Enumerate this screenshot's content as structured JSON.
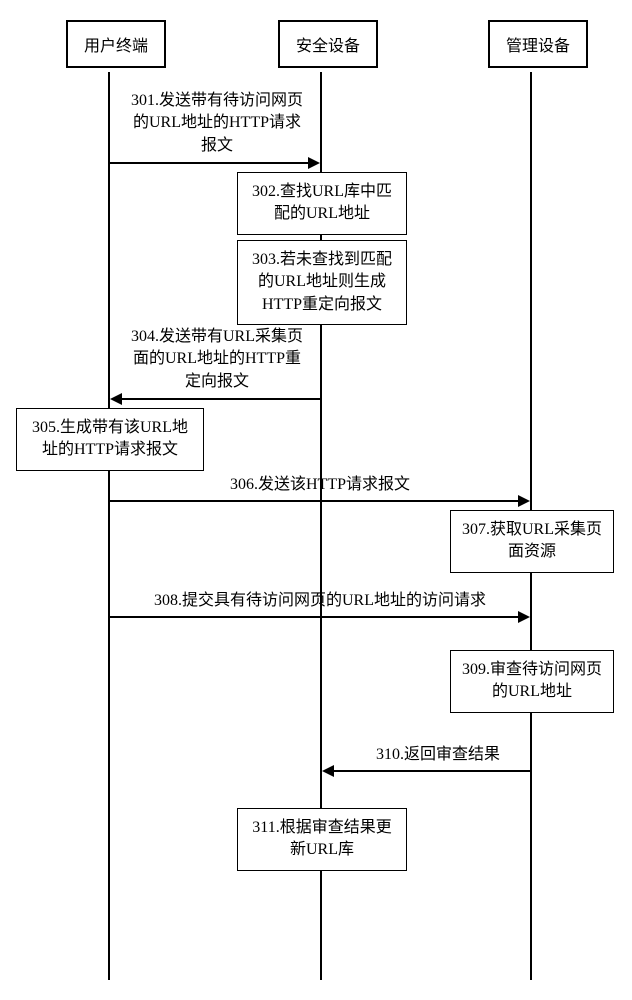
{
  "participants": {
    "user_terminal": "用户终端",
    "security_device": "安全设备",
    "management_device": "管理设备"
  },
  "messages": {
    "m301": "301.发送带有待访问网页的URL地址的HTTP请求报文",
    "m302": "302.查找URL库中匹配的URL地址",
    "m303": "303.若未查找到匹配的URL地址则生成HTTP重定向报文",
    "m304": "304.发送带有URL采集页面的URL地址的HTTP重定向报文",
    "m305": "305.生成带有该URL地址的HTTP请求报文",
    "m306": "306.发送该HTTP请求报文",
    "m307": "307.获取URL采集页面资源",
    "m308": "308.提交具有待访问网页的URL地址的访问请求",
    "m309": "309.审查待访问网页的URL地址",
    "m310": "310.返回审查结果",
    "m311": "311.根据审查结果更新URL库"
  }
}
